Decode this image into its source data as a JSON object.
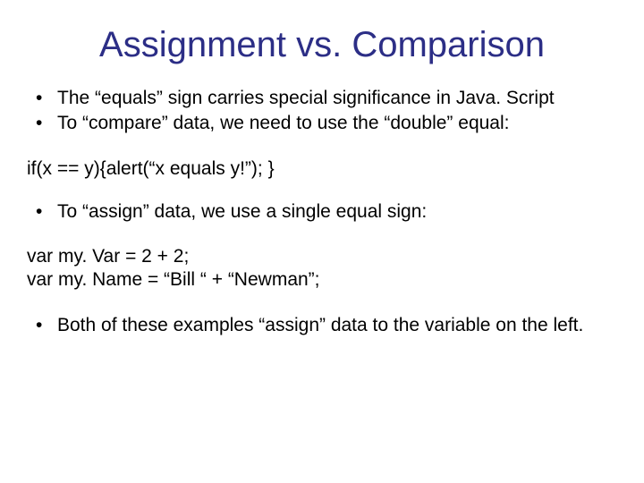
{
  "title": "Assignment vs. Comparison",
  "bullets_top": [
    "The “equals” sign carries special significance in Java. Script",
    "To “compare” data, we need to use the “double” equal:"
  ],
  "code1": "if(x == y){alert(“x equals y!”); }",
  "bullets_mid": [
    "To “assign” data, we use a single equal sign:"
  ],
  "code2a": "var my. Var = 2 + 2;",
  "code2b": "var my. Name = “Bill “ + “Newman”;",
  "bullets_bottom": [
    "Both of these examples “assign” data to the variable on the left."
  ]
}
